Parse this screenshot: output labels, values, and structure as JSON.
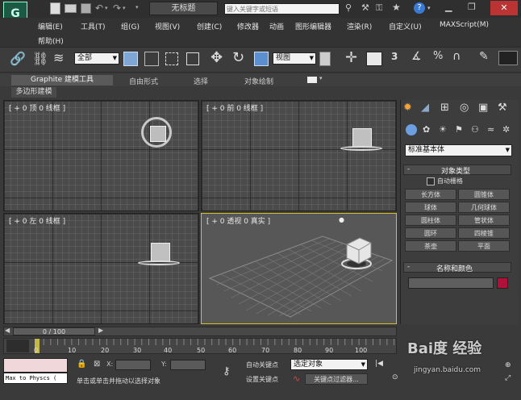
{
  "titlebar": {
    "tab": "无标题",
    "search_placeholder": "键入关键字或短语"
  },
  "menu": [
    "编辑(E)",
    "工具(T)",
    "组(G)",
    "视图(V)",
    "创建(C)",
    "修改器",
    "动画",
    "图形编辑器",
    "渲染(R)",
    "自定义(U)",
    "MAXScript(M)",
    "帮助(H)"
  ],
  "toolbar": {
    "selection_filter": "全部",
    "coord_system": "视图"
  },
  "ribbon": {
    "tabs": [
      "Graphite 建模工具",
      "自由形式",
      "选择",
      "对象绘制"
    ],
    "subtab": "多边形建模"
  },
  "viewports": [
    {
      "label": "[ + 0 顶 0 线框 ]"
    },
    {
      "label": "[ + 0 前 0 线框 ]"
    },
    {
      "label": "[ + 0 左 0 线框 ]"
    },
    {
      "label": "[ + 0 透视 0 真实 ]"
    }
  ],
  "command_panel": {
    "category": "标准基本体",
    "rollout_object_type": "对象类型",
    "autogrid": "自动栅格",
    "buttons": [
      "长方体",
      "圆锥体",
      "球体",
      "几何球体",
      "圆柱体",
      "管状体",
      "圆环",
      "四棱锥",
      "茶壶",
      "平面"
    ],
    "rollout_name_color": "名称和颜色",
    "object_color": "#b0103a"
  },
  "timeline": {
    "frame_readout": "0 / 100",
    "ticks": [
      "0",
      "10",
      "20",
      "30",
      "40",
      "50",
      "60",
      "70",
      "80",
      "90",
      "100"
    ]
  },
  "status": {
    "script_listener": "Max to Physcs (",
    "x_label": "X:",
    "y_label": "Y:",
    "prompt": "单击或单击并拖动以选择对象",
    "autokey": "自动关键点",
    "setkey": "设置关键点",
    "selected_dd": "选定对象",
    "key_filters": "关键点过滤器..."
  },
  "watermark": {
    "line1": "Bai度 经验",
    "line2": "jingyan.baidu.com"
  }
}
